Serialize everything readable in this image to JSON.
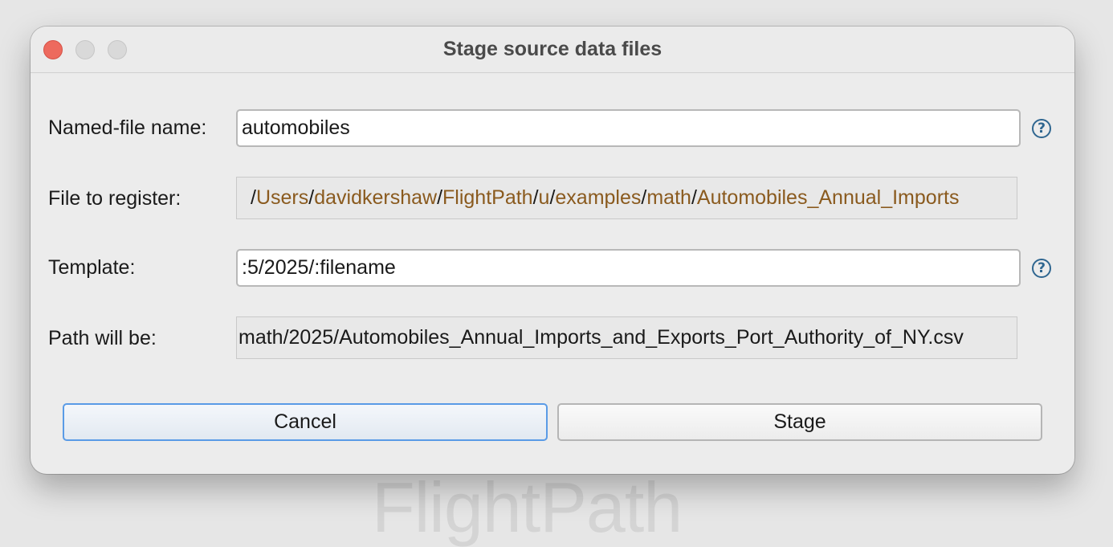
{
  "backdrop": {
    "logo_text": "FlightPath"
  },
  "window": {
    "title": "Stage source data files"
  },
  "form": {
    "named_file": {
      "label": "Named-file name:",
      "value": "automobiles"
    },
    "file_to_register": {
      "label": "File to register:",
      "path_segments": [
        "Users",
        "davidkershaw",
        "FlightPath",
        "u",
        "examples",
        "math",
        "Automobiles_Annual_Imports"
      ],
      "separator": "/"
    },
    "template": {
      "label": "Template:",
      "value": ":5/2025/:filename"
    },
    "path_will_be": {
      "label": "Path will be:",
      "value": "math/2025/Automobiles_Annual_Imports_and_Exports_Port_Authority_of_NY.csv"
    },
    "help_glyph": "?"
  },
  "buttons": {
    "cancel_label": "Cancel",
    "stage_label": "Stage"
  }
}
